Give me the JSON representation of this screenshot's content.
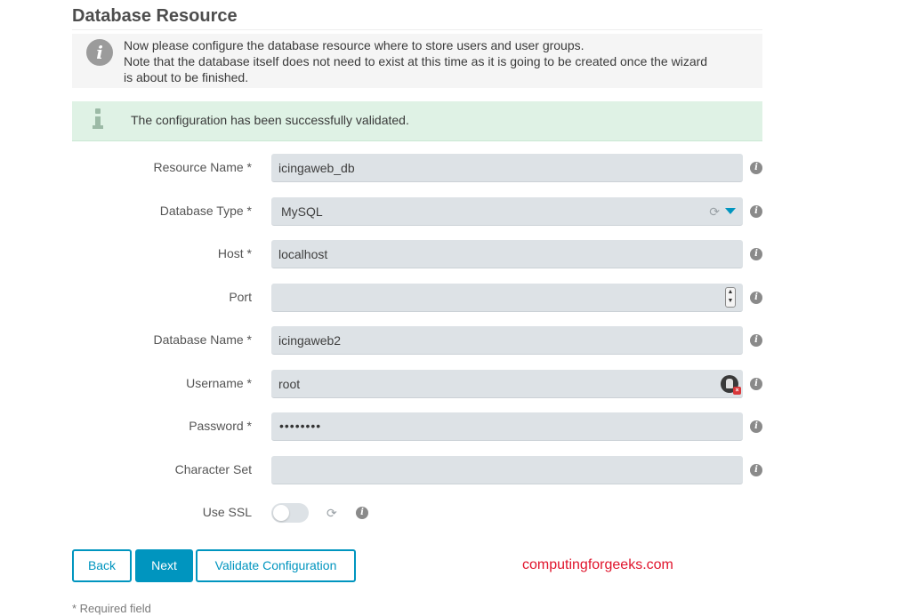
{
  "page": {
    "title": "Database Resource"
  },
  "info_box": {
    "icon": "info-circle-icon",
    "lines": [
      "Now please configure the database resource where to store users and user groups.",
      "Note that the database itself does not need to exist at this time as it is going to be created once the wizard",
      "is about to be finished."
    ]
  },
  "success_box": {
    "icon": "info-icon",
    "text": "The configuration has been successfully validated."
  },
  "form": {
    "resource_name": {
      "label": "Resource Name *",
      "value": "icingaweb_db"
    },
    "database_type": {
      "label": "Database Type *",
      "value": "MySQL"
    },
    "host": {
      "label": "Host *",
      "value": "localhost"
    },
    "port": {
      "label": "Port",
      "value": ""
    },
    "database_name": {
      "label": "Database Name *",
      "value": "icingaweb2"
    },
    "username": {
      "label": "Username *",
      "value": "root"
    },
    "password": {
      "label": "Password *",
      "value": "••••••••"
    },
    "character_set": {
      "label": "Character Set",
      "value": ""
    },
    "use_ssl": {
      "label": "Use SSL",
      "checked": false
    }
  },
  "buttons": {
    "back": "Back",
    "next": "Next",
    "validate": "Validate Configuration"
  },
  "watermark": "computingforgeeks.com",
  "required_note": "* Required field",
  "colors": {
    "accent": "#0095bf",
    "success_bg": "#dff2e5",
    "field_bg": "#dde2e6",
    "watermark": "#e0142c"
  }
}
